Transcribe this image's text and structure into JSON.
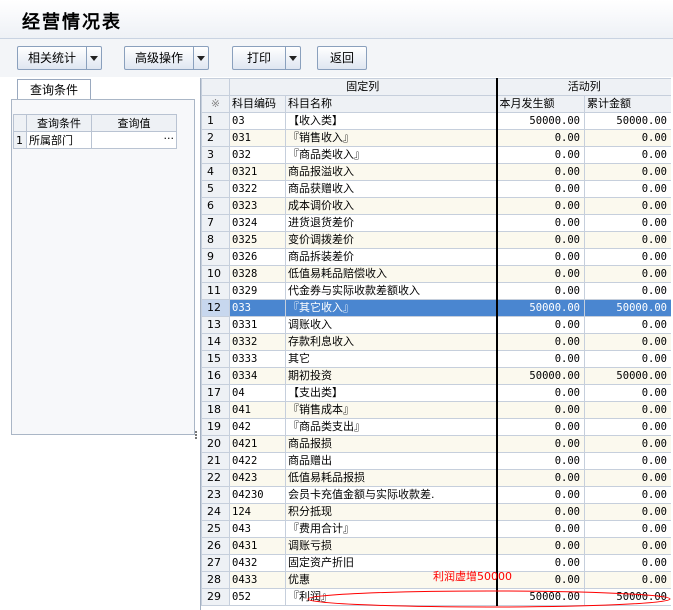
{
  "window": {
    "title": "经营情况表"
  },
  "toolbar": {
    "related_stats": "相关统计",
    "advanced_ops": "高级操作",
    "print": "打印",
    "back": "返回"
  },
  "query_panel": {
    "tab_label": "查询条件",
    "headers": [
      "查询条件",
      "查询值"
    ],
    "rows": [
      {
        "index": "1",
        "condition": "所属部门",
        "value": "",
        "more": "···"
      }
    ]
  },
  "grid": {
    "group_headers": [
      "固定列",
      "活动列"
    ],
    "corner_symbol": "※",
    "columns": [
      "科目编码",
      "科目名称",
      "本月发生额",
      "累计金额"
    ],
    "rows": [
      {
        "n": "1",
        "code": "03",
        "name": "【收入类】",
        "level": 1,
        "month": "50000.00",
        "total": "50000.00"
      },
      {
        "n": "2",
        "code": "031",
        "name": "『销售收入』",
        "level": 2,
        "month": "0.00",
        "total": "0.00"
      },
      {
        "n": "3",
        "code": "032",
        "name": "『商品类收入』",
        "level": 2,
        "month": "0.00",
        "total": "0.00"
      },
      {
        "n": "4",
        "code": "0321",
        "name": "商品报溢收入",
        "level": 3,
        "month": "0.00",
        "total": "0.00"
      },
      {
        "n": "5",
        "code": "0322",
        "name": "商品获赠收入",
        "level": 3,
        "month": "0.00",
        "total": "0.00"
      },
      {
        "n": "6",
        "code": "0323",
        "name": "成本调价收入",
        "level": 3,
        "month": "0.00",
        "total": "0.00"
      },
      {
        "n": "7",
        "code": "0324",
        "name": "进货退货差价",
        "level": 3,
        "month": "0.00",
        "total": "0.00"
      },
      {
        "n": "8",
        "code": "0325",
        "name": "变价调拨差价",
        "level": 3,
        "month": "0.00",
        "total": "0.00"
      },
      {
        "n": "9",
        "code": "0326",
        "name": "商品拆装差价",
        "level": 3,
        "month": "0.00",
        "total": "0.00"
      },
      {
        "n": "10",
        "code": "0328",
        "name": "低值易耗品赔偿收入",
        "level": 3,
        "month": "0.00",
        "total": "0.00"
      },
      {
        "n": "11",
        "code": "0329",
        "name": "代金券与实际收款差额收入",
        "level": 3,
        "month": "0.00",
        "total": "0.00"
      },
      {
        "n": "12",
        "code": "033",
        "name": "『其它收入』",
        "level": 2,
        "month": "50000.00",
        "total": "50000.00",
        "selected": true
      },
      {
        "n": "13",
        "code": "0331",
        "name": "调账收入",
        "level": 3,
        "month": "0.00",
        "total": "0.00"
      },
      {
        "n": "14",
        "code": "0332",
        "name": "存款利息收入",
        "level": 3,
        "month": "0.00",
        "total": "0.00"
      },
      {
        "n": "15",
        "code": "0333",
        "name": "其它",
        "level": 3,
        "month": "0.00",
        "total": "0.00"
      },
      {
        "n": "16",
        "code": "0334",
        "name": "期初投资",
        "level": 3,
        "month": "50000.00",
        "total": "50000.00"
      },
      {
        "n": "17",
        "code": "04",
        "name": "【支出类】",
        "level": 1,
        "month": "0.00",
        "total": "0.00"
      },
      {
        "n": "18",
        "code": "041",
        "name": "『销售成本』",
        "level": 2,
        "month": "0.00",
        "total": "0.00"
      },
      {
        "n": "19",
        "code": "042",
        "name": "『商品类支出』",
        "level": 2,
        "month": "0.00",
        "total": "0.00"
      },
      {
        "n": "20",
        "code": "0421",
        "name": "商品报损",
        "level": 3,
        "month": "0.00",
        "total": "0.00"
      },
      {
        "n": "21",
        "code": "0422",
        "name": "商品赠出",
        "level": 3,
        "month": "0.00",
        "total": "0.00"
      },
      {
        "n": "22",
        "code": "0423",
        "name": "低值易耗品报损",
        "level": 3,
        "month": "0.00",
        "total": "0.00"
      },
      {
        "n": "23",
        "code": "04230",
        "name": "会员卡充值金额与实际收款差.",
        "level": 3,
        "month": "0.00",
        "total": "0.00"
      },
      {
        "n": "24",
        "code": "124",
        "name": "积分抵现",
        "level": 3,
        "month": "0.00",
        "total": "0.00"
      },
      {
        "n": "25",
        "code": "043",
        "name": "『费用合计』",
        "level": 2,
        "month": "0.00",
        "total": "0.00"
      },
      {
        "n": "26",
        "code": "0431",
        "name": "调账亏损",
        "level": 3,
        "month": "0.00",
        "total": "0.00"
      },
      {
        "n": "27",
        "code": "0432",
        "name": "固定资产折旧",
        "level": 3,
        "month": "0.00",
        "total": "0.00"
      },
      {
        "n": "28",
        "code": "0433",
        "name": "优惠",
        "level": 3,
        "month": "0.00",
        "total": "0.00"
      },
      {
        "n": "29",
        "code": "052",
        "name": "『利润』",
        "level": 2,
        "month": "50000.00",
        "total": "50000.00"
      }
    ]
  },
  "annotation": {
    "text": "利润虚增50000",
    "color": "#ff0000"
  }
}
